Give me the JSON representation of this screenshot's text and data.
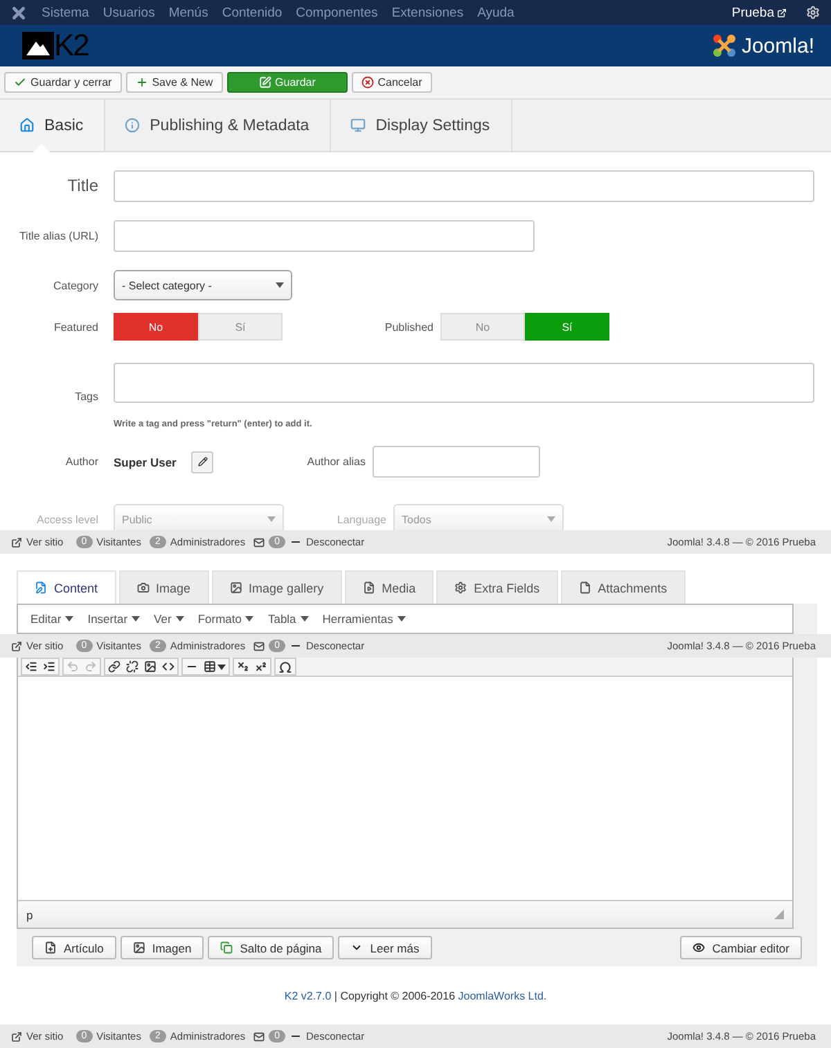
{
  "top_menu": {
    "items": [
      "Sistema",
      "Usuarios",
      "Menús",
      "Contenido",
      "Componentes",
      "Extensiones",
      "Ayuda"
    ],
    "user": "Prueba"
  },
  "header": {
    "logo_text": "K2",
    "brand_text": "Joomla!"
  },
  "toolbar": [
    {
      "label": "Guardar y cerrar",
      "kind": "save-close",
      "primary": false
    },
    {
      "label": "Save & New",
      "kind": "new",
      "primary": false
    },
    {
      "label": "Guardar",
      "kind": "save",
      "primary": true
    },
    {
      "label": "Cancelar",
      "kind": "cancel",
      "primary": false
    }
  ],
  "tabs": [
    {
      "label": "Basic",
      "kind": "home",
      "selected": true
    },
    {
      "label": "Publishing & Metadata",
      "kind": "info",
      "selected": false
    },
    {
      "label": "Display Settings",
      "kind": "display",
      "selected": false
    }
  ],
  "form": {
    "title_label": "Title",
    "alias_label": "Title alias (URL)",
    "category_label": "Category",
    "category_value": "- Select category -",
    "featured": {
      "label": "Featured",
      "options": [
        {
          "label": "No",
          "selected": true
        },
        {
          "label": "Sí",
          "selected": false
        }
      ]
    },
    "published": {
      "label": "Published",
      "options": [
        {
          "label": "No",
          "selected": false
        },
        {
          "label": "Sí",
          "selected": true
        }
      ]
    },
    "tags_label": "Tags",
    "tags_hint": "Write a tag and press \"return\" (enter) to add it.",
    "author_label": "Author",
    "author_value": "Super User",
    "author_alias_label": "Author alias",
    "access_label": "Access level",
    "access_value": "Public",
    "language_label": "Language",
    "language_value": "Todos"
  },
  "status_bars": [
    {
      "view_site": "Ver sitio",
      "visitors_count": "0",
      "visitors": "Visitantes",
      "admins_count": "2",
      "admins": "Administradores",
      "messages_count": "0",
      "logout": "Desconectar",
      "version": "Joomla! 3.4.8 — © 2016 Prueba"
    },
    {
      "view_site": "Ver sitio",
      "visitors_count": "0",
      "visitors": "Visitantes",
      "admins_count": "2",
      "admins": "Administradores",
      "messages_count": "0",
      "logout": "Desconectar",
      "version": "Joomla! 3.4.8 — © 2016 Prueba"
    },
    {
      "view_site": "Ver sitio",
      "visitors_count": "0",
      "visitors": "Visitantes",
      "admins_count": "2",
      "admins": "Administradores",
      "messages_count": "0",
      "logout": "Desconectar",
      "version": "Joomla! 3.4.8 — © 2016 Prueba"
    }
  ],
  "content_tabs": [
    {
      "label": "Content",
      "kind": "file-edit",
      "selected": true
    },
    {
      "label": "Image",
      "kind": "camera",
      "selected": false
    },
    {
      "label": "Image gallery",
      "kind": "image",
      "selected": false
    },
    {
      "label": "Media",
      "kind": "media",
      "selected": false
    },
    {
      "label": "Extra Fields",
      "kind": "gear",
      "selected": false
    },
    {
      "label": "Attachments",
      "kind": "file",
      "selected": false
    }
  ],
  "editor_menu": [
    "Editar",
    "Insertar",
    "Ver",
    "Formato",
    "Tabla",
    "Herramientas"
  ],
  "editor_toolbar": [
    [
      {
        "kind": "outdent",
        "disabled": false
      },
      {
        "kind": "indent",
        "disabled": false
      }
    ],
    [
      {
        "kind": "undo",
        "disabled": true
      },
      {
        "kind": "redo",
        "disabled": true
      }
    ],
    [
      {
        "kind": "link",
        "disabled": false
      },
      {
        "kind": "unlink",
        "disabled": false
      },
      {
        "kind": "image",
        "disabled": false
      },
      {
        "kind": "code",
        "disabled": false
      }
    ],
    [
      {
        "kind": "hr",
        "disabled": false
      },
      {
        "kind": "table",
        "disabled": false
      }
    ],
    [
      {
        "kind": "subscript",
        "disabled": false
      },
      {
        "kind": "superscript",
        "disabled": false
      }
    ],
    [
      {
        "kind": "omega",
        "disabled": false
      }
    ]
  ],
  "editor_path": "p",
  "editor_buttons": [
    {
      "label": "Artículo",
      "kind": "article"
    },
    {
      "label": "Imagen",
      "kind": "image"
    },
    {
      "label": "Salto de página",
      "kind": "pagebreak"
    },
    {
      "label": "Leer más",
      "kind": "readmore"
    }
  ],
  "toggle_editor": "Cambiar editor",
  "footer": {
    "version_link": "K2 v2.7.0",
    "copyright": " | Copyright © 2006-2016 ",
    "company_link": "JoomlaWorks Ltd."
  }
}
